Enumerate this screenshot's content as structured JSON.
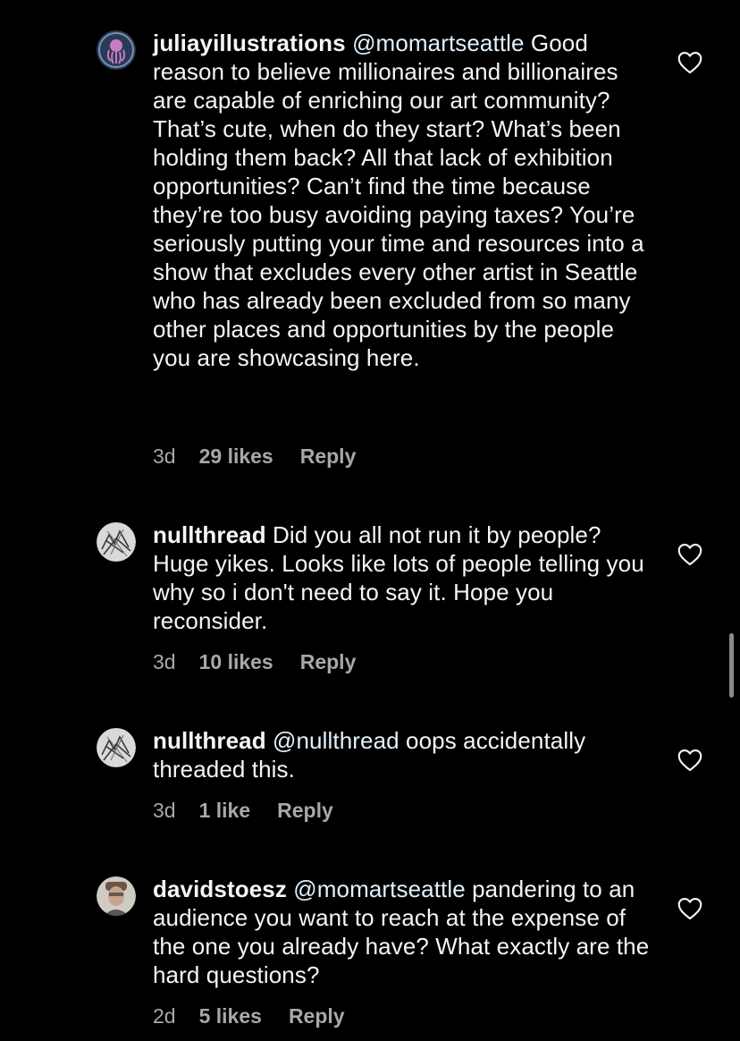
{
  "comments": [
    {
      "username": "juliayillustrations",
      "mention": "@momartseattle",
      "text": " Good reason to believe millionaires and billionaires are capable of enriching our art community? That’s cute, when do they start? What’s been holding them back? All that lack of exhibition opportunities? Can’t find the time because they’re too busy avoiding paying taxes? You’re seriously putting your time and resources into a show that excludes every other artist in Seattle who has already been excluded from so many other places and opportunities by the people you are showcasing here.",
      "time": "3d",
      "likes": "29 likes",
      "reply": "Reply",
      "avatar_icon": "octopus-avatar-icon",
      "avatar_color": "#7a8fb5"
    },
    {
      "username": "nullthread",
      "mention": "",
      "text": " Did you all not run it by people? Huge yikes. Looks like lots of people telling you why so i don't need to say it. Hope you reconsider.",
      "time": "3d",
      "likes": "10 likes",
      "reply": "Reply",
      "avatar_icon": "sketch-avatar-icon",
      "avatar_color": "#d9d9d9"
    },
    {
      "username": "nullthread",
      "mention": "@nullthread",
      "text": " oops accidentally threaded this.",
      "time": "3d",
      "likes": "1 like",
      "reply": "Reply",
      "avatar_icon": "sketch-avatar-icon",
      "avatar_color": "#d9d9d9"
    },
    {
      "username": "davidstoesz",
      "mention": "@momartseattle",
      "text": " pandering to an audience you want to reach at the expense of the one you already have? What exactly are the hard questions?",
      "time": "2d",
      "likes": "5 likes",
      "reply": "Reply",
      "avatar_icon": "person-photo-avatar-icon",
      "avatar_color": "#8c7b6e"
    }
  ],
  "colors": {
    "background": "#000000",
    "text": "#f5f5f5",
    "mention": "#e0f1ff",
    "meta": "#a8a8a8"
  },
  "icons": {
    "like": "heart-outline-icon"
  }
}
